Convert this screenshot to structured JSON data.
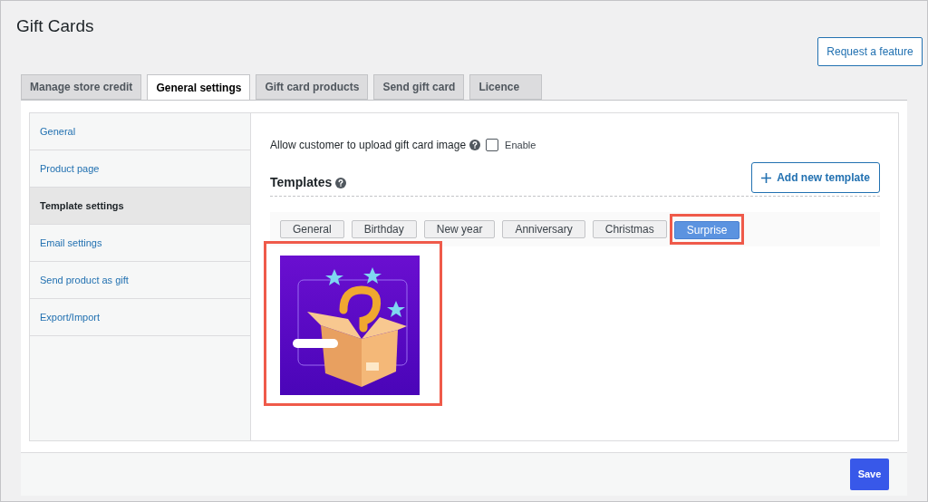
{
  "page_title": "Gift Cards",
  "request_button": "Request a feature",
  "tabs": [
    {
      "label": "Manage store credit",
      "selected": false
    },
    {
      "label": "General settings",
      "selected": true
    },
    {
      "label": "Gift card products",
      "selected": false
    },
    {
      "label": "Send gift card",
      "selected": false
    },
    {
      "label": "Licence",
      "selected": false
    }
  ],
  "sidebar": {
    "items": [
      {
        "label": "General",
        "selected": false
      },
      {
        "label": "Product page",
        "selected": false
      },
      {
        "label": "Template settings",
        "selected": true
      },
      {
        "label": "Email settings",
        "selected": false
      },
      {
        "label": "Send product as gift",
        "selected": false
      },
      {
        "label": "Export/Import",
        "selected": false
      }
    ]
  },
  "upload_option": {
    "label": "Allow customer to upload gift card image",
    "checkbox_label": "Enable",
    "checked": false
  },
  "templates": {
    "heading": "Templates",
    "add_button": "Add new template",
    "categories": [
      {
        "label": "General",
        "selected": false,
        "highlighted": false
      },
      {
        "label": "Birthday",
        "selected": false,
        "highlighted": false
      },
      {
        "label": "New year",
        "selected": false,
        "highlighted": false
      },
      {
        "label": "Anniversary",
        "selected": false,
        "highlighted": false
      },
      {
        "label": "Christmas",
        "selected": false,
        "highlighted": false
      },
      {
        "label": "Surprise",
        "selected": true,
        "highlighted": true
      }
    ],
    "images": [
      {
        "kind": "picture",
        "highlighted": true
      }
    ]
  },
  "save_button": "Save"
}
